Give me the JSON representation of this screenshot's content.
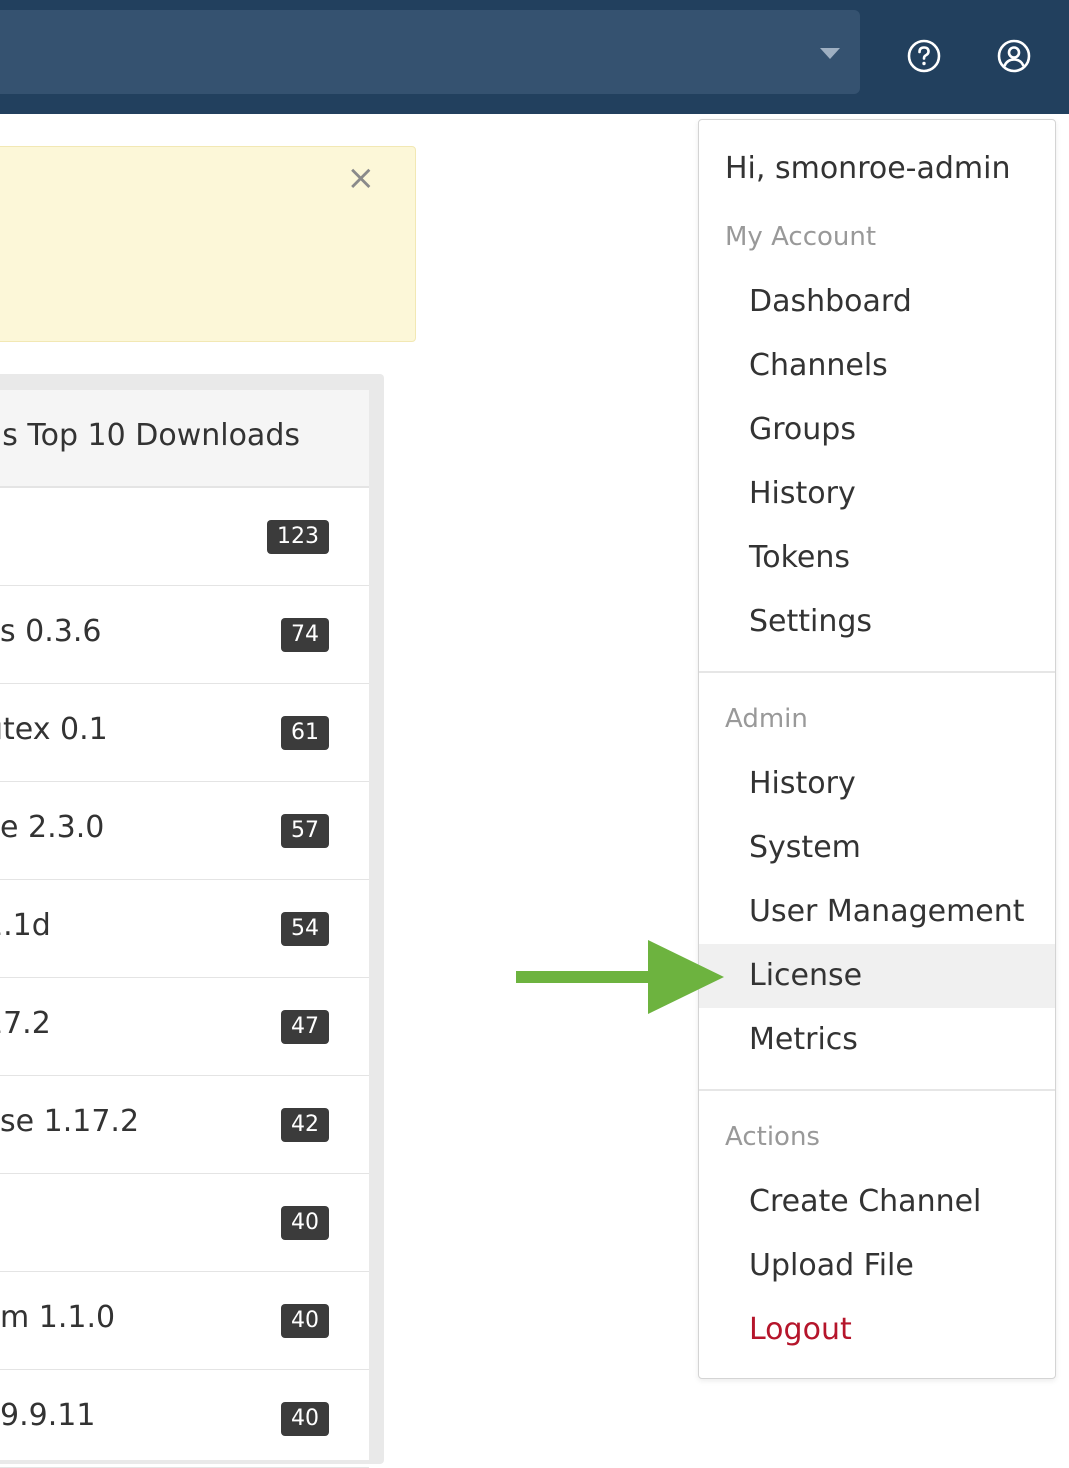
{
  "topbar": {
    "help_icon": "question-circle-icon",
    "user_icon": "user-circle-icon"
  },
  "alert": {
    "close_label": "×"
  },
  "downloads": {
    "title": "'s Top 10 Downloads",
    "rows": [
      {
        "name": "",
        "count": "123"
      },
      {
        "name": "s 0.3.6",
        "count": "74"
      },
      {
        "name": "utex 0.1",
        "count": "61"
      },
      {
        "name": "e 2.3.0",
        "count": "57"
      },
      {
        "name": "1.1d",
        "count": "54"
      },
      {
        "name": "17.2",
        "count": "47"
      },
      {
        "name": "se 1.17.2",
        "count": "42"
      },
      {
        "name": "",
        "count": "40"
      },
      {
        "name": "m 1.1.0",
        "count": "40"
      },
      {
        "name": "9.9.11",
        "count": "40"
      }
    ]
  },
  "user_menu": {
    "greeting": "Hi, smonroe-admin",
    "my_account": {
      "heading": "My Account",
      "items": [
        "Dashboard",
        "Channels",
        "Groups",
        "History",
        "Tokens",
        "Settings"
      ]
    },
    "admin": {
      "heading": "Admin",
      "items": [
        "History",
        "System",
        "User Management",
        "License",
        "Metrics"
      ]
    },
    "actions": {
      "heading": "Actions",
      "items": [
        "Create Channel",
        "Upload File",
        "Logout"
      ]
    }
  },
  "colors": {
    "topbar": "#22405e",
    "arrow": "#6db33f",
    "logout": "#b5152b",
    "alert_bg": "#fcf7d8"
  }
}
